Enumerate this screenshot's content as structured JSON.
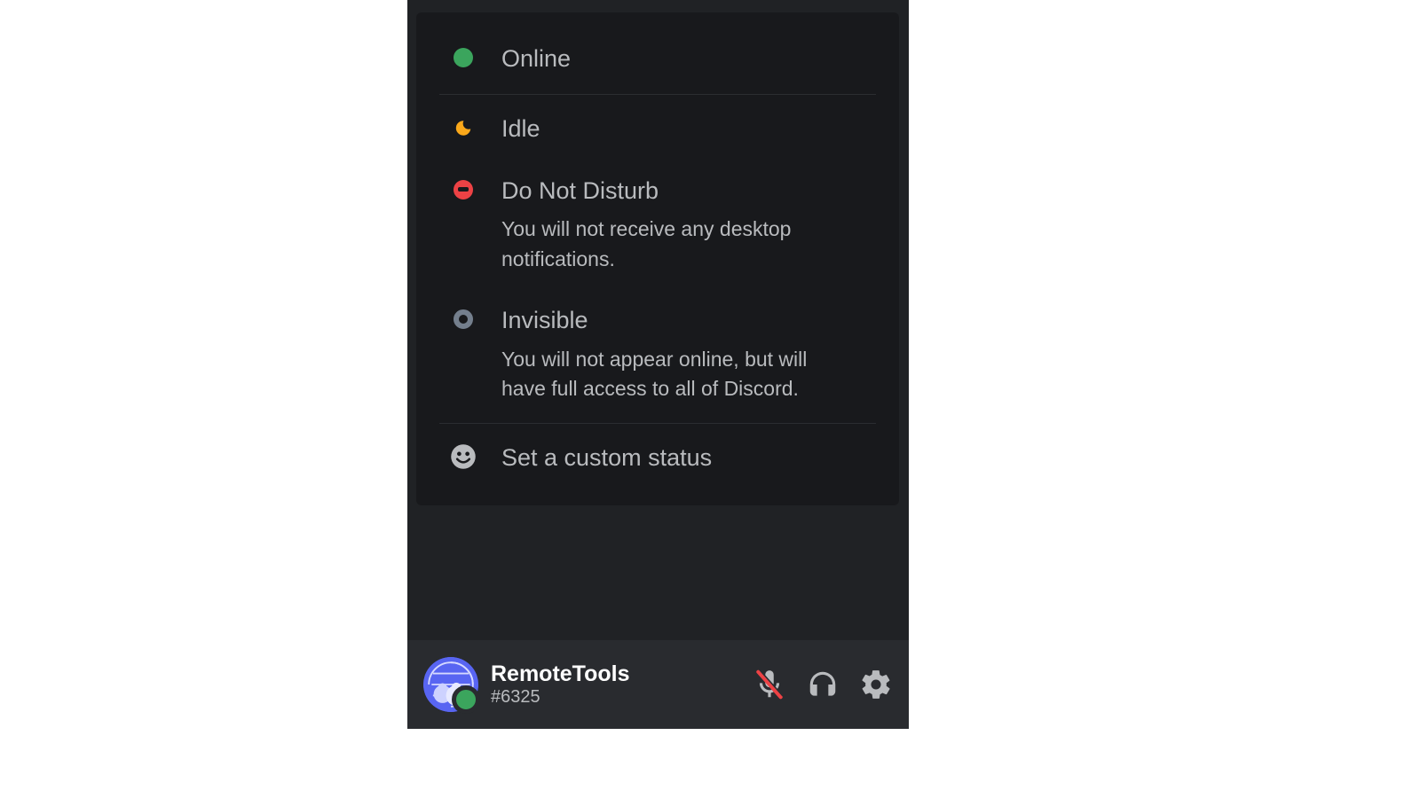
{
  "status_menu": {
    "online": {
      "label": "Online"
    },
    "idle": {
      "label": "Idle"
    },
    "dnd": {
      "label": "Do Not Disturb",
      "desc": "You will not receive any desktop notifications."
    },
    "invisible": {
      "label": "Invisible",
      "desc": "You will not appear online, but will have full access to all of Discord."
    },
    "custom": {
      "label": "Set a custom status"
    }
  },
  "user": {
    "name": "RemoteTools",
    "discriminator": "#6325"
  },
  "colors": {
    "online": "#3ba55d",
    "idle": "#faa81a",
    "dnd": "#ed4245",
    "offline": "#747f8d"
  }
}
